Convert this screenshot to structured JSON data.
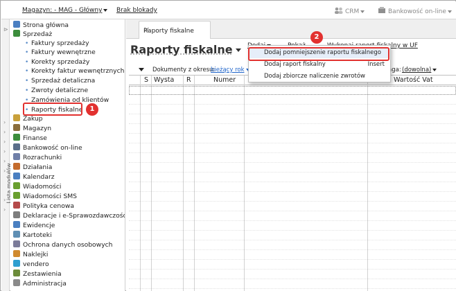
{
  "topbar": {
    "warehouse": "Magazyn: - MAG - Główny",
    "locks": "Brak blokady",
    "crm": "CRM",
    "banking": "Bankowość on-line"
  },
  "rail": {
    "label": "Lista modułów"
  },
  "sidebar": {
    "top_items": [
      {
        "label": "Strona główna",
        "icon": "home-icon",
        "color": "#4a7fc1"
      },
      {
        "label": "Sprzedaż",
        "icon": "sales-icon",
        "color": "#3c8d3c"
      }
    ],
    "sales_sub": [
      "Faktury sprzedaży",
      "Faktury wewnętrzne",
      "Korekty sprzedaży",
      "Korekty faktur wewnętrznych",
      "Sprzedaż detaliczna",
      "Zwroty detaliczne",
      "Zamówienia od klientów",
      "Raporty fiskalne"
    ],
    "modules": [
      {
        "label": "Zakup",
        "icon": "purchase-icon",
        "color": "#c9a13b"
      },
      {
        "label": "Magazyn",
        "icon": "warehouse-icon",
        "color": "#8a6d3b"
      },
      {
        "label": "Finanse",
        "icon": "finance-icon",
        "color": "#3c8d3c"
      },
      {
        "label": "Bankowość on-line",
        "icon": "bank-icon",
        "color": "#5a6e8a"
      },
      {
        "label": "Rozrachunki",
        "icon": "settlement-icon",
        "color": "#6f7fa8"
      },
      {
        "label": "Działania",
        "icon": "actions-icon",
        "color": "#c46b2d"
      },
      {
        "label": "Kalendarz",
        "icon": "calendar-icon",
        "color": "#4a7fc1"
      },
      {
        "label": "Wiadomości",
        "icon": "message-icon",
        "color": "#6a9f2f"
      },
      {
        "label": "Wiadomości SMS",
        "icon": "sms-icon",
        "color": "#6a9f2f"
      },
      {
        "label": "Polityka cenowa",
        "icon": "price-icon",
        "color": "#b54a4a"
      },
      {
        "label": "Deklaracje i e-Sprawozdawczość",
        "icon": "declaration-icon",
        "color": "#7d7d7d"
      },
      {
        "label": "Ewidencje",
        "icon": "register-icon",
        "color": "#4a7fc1"
      },
      {
        "label": "Kartoteki",
        "icon": "files-icon",
        "color": "#5f8fb4"
      },
      {
        "label": "Ochrona danych osobowych",
        "icon": "shield-icon",
        "color": "#7c7c9a"
      },
      {
        "label": "Naklejki",
        "icon": "label-icon",
        "color": "#d08a2e"
      },
      {
        "label": "vendero",
        "icon": "vendero-icon",
        "color": "#2f9fd0"
      },
      {
        "label": "Zestawienia",
        "icon": "report-icon",
        "color": "#6c8c3a"
      },
      {
        "label": "Administracja",
        "icon": "admin-icon",
        "color": "#8a8a8a"
      }
    ],
    "badge1": "1"
  },
  "main": {
    "tab": "Raporty fiskalne",
    "title": "Raporty fiskalne",
    "menu": {
      "add": "Dodaj",
      "show": "Pokaż",
      "run": "Wykonaj raport fiskalny w UF"
    },
    "dropdown": {
      "items": [
        {
          "label": "Dodaj pomniejszenie raportu fiskalnego",
          "shortcut": ""
        },
        {
          "label": "Dodaj raport fiskalny",
          "shortcut": "Insert"
        },
        {
          "label": "Dodaj zbiorcze naliczenie zwrotów",
          "shortcut": ""
        }
      ]
    },
    "badge2": "2",
    "filter": {
      "period_label": "Dokumenty z okresu:",
      "period_value": "bieżący rok",
      "tag_label": "aga:",
      "tag_value": "(dowolna)"
    },
    "columns": [
      "S",
      "Wysta",
      "R",
      "Numer",
      "Wartość Vat"
    ]
  }
}
